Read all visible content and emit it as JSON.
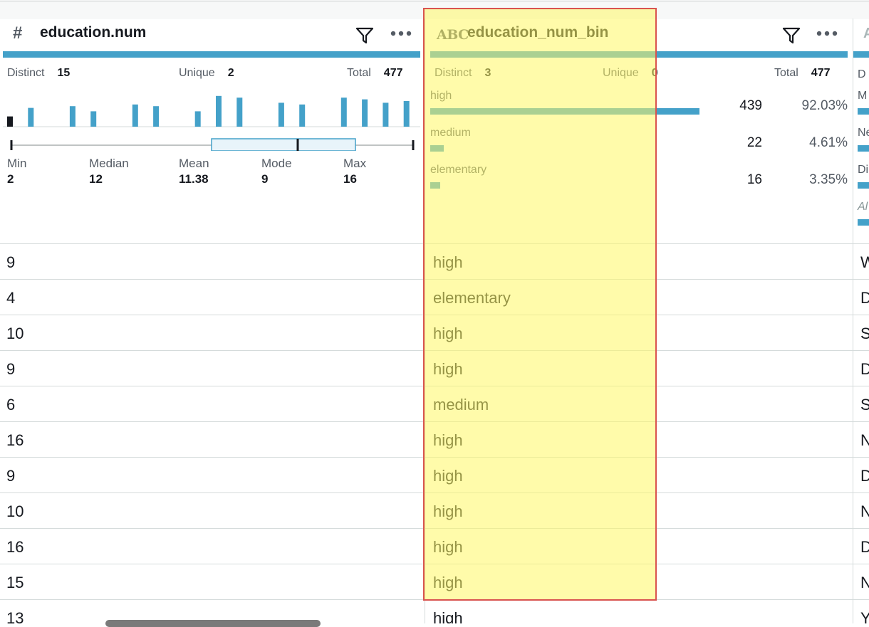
{
  "columns": [
    {
      "type_icon": "#",
      "name": "education.num",
      "stats": {
        "distinct_label": "Distinct",
        "distinct": "15",
        "unique_label": "Unique",
        "unique": "2",
        "total_label": "Total",
        "total": "477"
      },
      "histogram": [
        0.3,
        0.55,
        0,
        0.6,
        0.45,
        0,
        0.65,
        0.6,
        0,
        0.45,
        0.9,
        0.85,
        0,
        0.7,
        0.65,
        0,
        0.85,
        0.8,
        0.7,
        0.75
      ],
      "summary": [
        {
          "label": "Min",
          "value": "2"
        },
        {
          "label": "Median",
          "value": "12"
        },
        {
          "label": "Mean",
          "value": "11.38"
        },
        {
          "label": "Mode",
          "value": "9"
        },
        {
          "label": "Max",
          "value": "16"
        }
      ],
      "rows": [
        "9",
        "4",
        "10",
        "9",
        "6",
        "16",
        "9",
        "10",
        "16",
        "15",
        "13"
      ]
    },
    {
      "type_icon": "ABC",
      "name": "education_num_bin",
      "stats": {
        "distinct_label": "Distinct",
        "distinct": "3",
        "unique_label": "Unique",
        "unique": "0",
        "total_label": "Total",
        "total": "477"
      },
      "categories": [
        {
          "label": "high",
          "count": "439",
          "percent": "92.03%",
          "fraction": 0.9203
        },
        {
          "label": "medium",
          "count": "22",
          "percent": "4.61%",
          "fraction": 0.0461
        },
        {
          "label": "elementary",
          "count": "16",
          "percent": "3.35%",
          "fraction": 0.0335
        }
      ],
      "rows": [
        "high",
        "elementary",
        "high",
        "high",
        "medium",
        "high",
        "high",
        "high",
        "high",
        "high",
        "high"
      ]
    },
    {
      "type_icon": "A",
      "partial_labels": [
        "D",
        "M",
        "Ne",
        "Di",
        "Al"
      ],
      "rows": [
        "W",
        "D",
        "S",
        "D",
        "S",
        "N",
        "D",
        "N",
        "D",
        "N",
        "Y"
      ]
    }
  ],
  "colors": {
    "bar": "#44a1c9",
    "highlight": "#fff764",
    "highlight_border": "#d9534f"
  }
}
